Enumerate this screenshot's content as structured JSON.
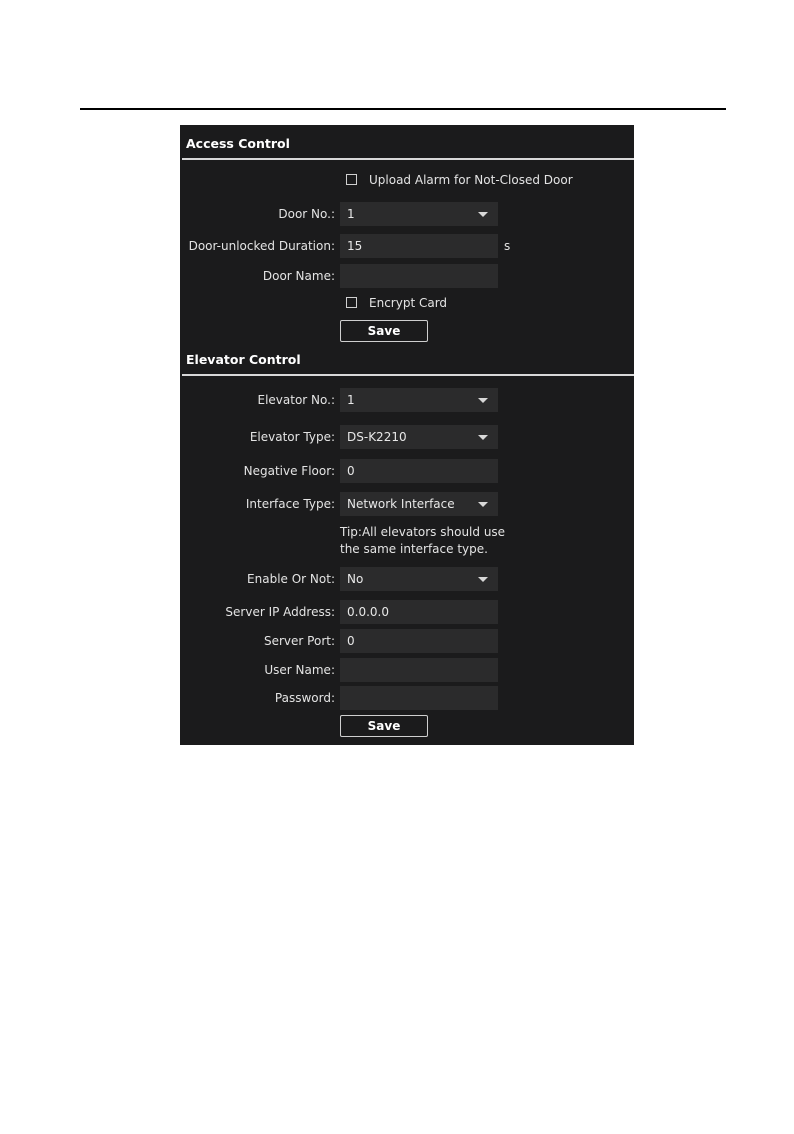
{
  "access_control": {
    "title": "Access Control",
    "upload_alarm_label": "Upload Alarm for Not-Closed Door",
    "upload_alarm_checked": false,
    "door_no_label": "Door No.:",
    "door_no_value": "1",
    "unlock_duration_label": "Door-unlocked Duration:",
    "unlock_duration_value": "15",
    "unlock_duration_unit": "s",
    "door_name_label": "Door Name:",
    "door_name_value": "",
    "encrypt_card_label": "Encrypt Card",
    "encrypt_card_checked": false,
    "save_label": "Save"
  },
  "elevator_control": {
    "title": "Elevator Control",
    "elevator_no_label": "Elevator No.:",
    "elevator_no_value": "1",
    "elevator_type_label": "Elevator Type:",
    "elevator_type_value": "DS-K2210",
    "negative_floor_label": "Negative Floor:",
    "negative_floor_value": "0",
    "interface_type_label": "Interface Type:",
    "interface_type_value": "Network Interface",
    "tip_line1": "Tip:All elevators should use",
    "tip_line2": "the same interface type.",
    "enable_label": "Enable Or Not:",
    "enable_value": "No",
    "server_ip_label": "Server IP Address:",
    "server_ip_value": "0.0.0.0",
    "server_port_label": "Server Port:",
    "server_port_value": "0",
    "user_name_label": "User Name:",
    "user_name_value": "",
    "password_label": "Password:",
    "password_value": "",
    "save_label": "Save"
  },
  "colors": {
    "panel_background": "#1b1b1c",
    "field_background": "#2b2b2c",
    "text": "#e4e4e4"
  }
}
